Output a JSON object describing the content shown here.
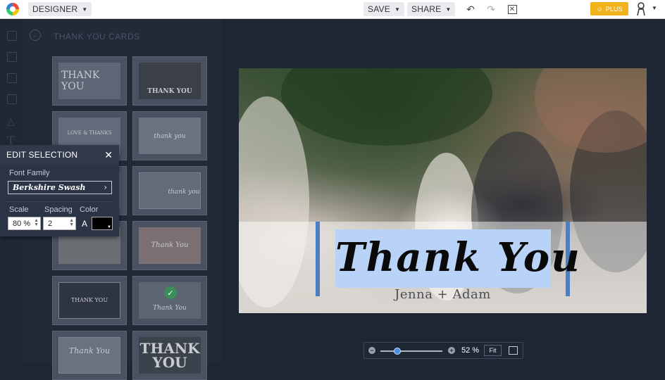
{
  "topbar": {
    "designer_label": "DESIGNER",
    "save_label": "SAVE",
    "share_label": "SHARE",
    "undo_icon": "undo-icon",
    "redo_icon": "redo-icon",
    "close_icon": "close-icon",
    "plus_label": "PLUS"
  },
  "panel": {
    "title": "THANK YOU CARDS",
    "thumbnails": [
      {
        "text": "THANK YOU"
      },
      {
        "text": "THANK YOU"
      },
      {
        "text": "LOVE & THANKS"
      },
      {
        "text": "thank you"
      },
      {
        "text": ""
      },
      {
        "text": "thank you"
      },
      {
        "text": ""
      },
      {
        "text": "Thank You"
      },
      {
        "text": "THANK YOU"
      },
      {
        "text": "Thank You"
      },
      {
        "text": "Thank You"
      },
      {
        "text": "THANK YOU"
      }
    ]
  },
  "edit_selection": {
    "title": "EDIT SELECTION",
    "font_family_label": "Font Family",
    "font_value": "Berkshire Swash",
    "scale_label": "Scale",
    "spacing_label": "Spacing",
    "color_label": "Color",
    "scale_value": "80 %",
    "spacing_value": "2",
    "align_label": "A",
    "color_value": "#000000"
  },
  "canvas": {
    "headline": "Thank You",
    "subline": "Jenna + Adam",
    "highlight_color": "#b9d2f7",
    "bar_color": "#4a7fc1"
  },
  "zoom": {
    "value": "52 %",
    "level": 0.52,
    "fit_label": "Fit"
  },
  "colors": {
    "accent_plus": "#f0b31b",
    "background": "#1e2633"
  }
}
